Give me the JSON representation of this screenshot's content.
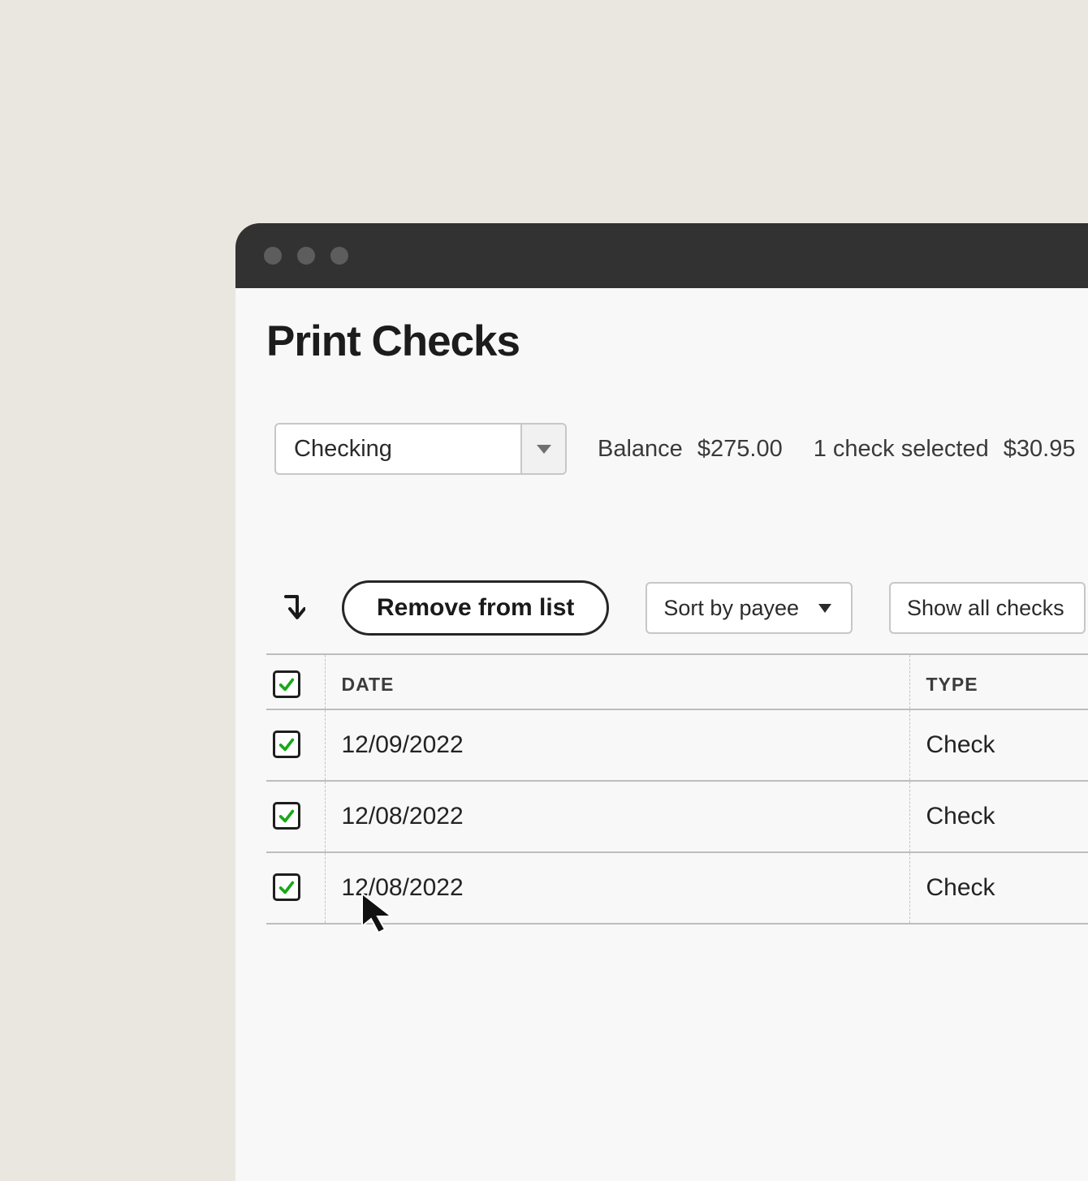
{
  "page": {
    "title": "Print Checks"
  },
  "account_select": {
    "value": "Checking"
  },
  "summary": {
    "balance_label": "Balance",
    "balance_value": "$275.00",
    "selected_label": "1 check selected",
    "selected_value": "$30.95"
  },
  "toolbar": {
    "remove_label": "Remove from list",
    "sort_label": "Sort by payee",
    "filter_label": "Show all checks"
  },
  "table": {
    "headers": {
      "date": "DATE",
      "type": "TYPE"
    },
    "rows": [
      {
        "checked": true,
        "date": "12/09/2022",
        "type": "Check"
      },
      {
        "checked": true,
        "date": "12/08/2022",
        "type": "Check"
      },
      {
        "checked": true,
        "date": "12/08/2022",
        "type": "Check"
      }
    ]
  },
  "colors": {
    "check_green": "#18a818"
  }
}
